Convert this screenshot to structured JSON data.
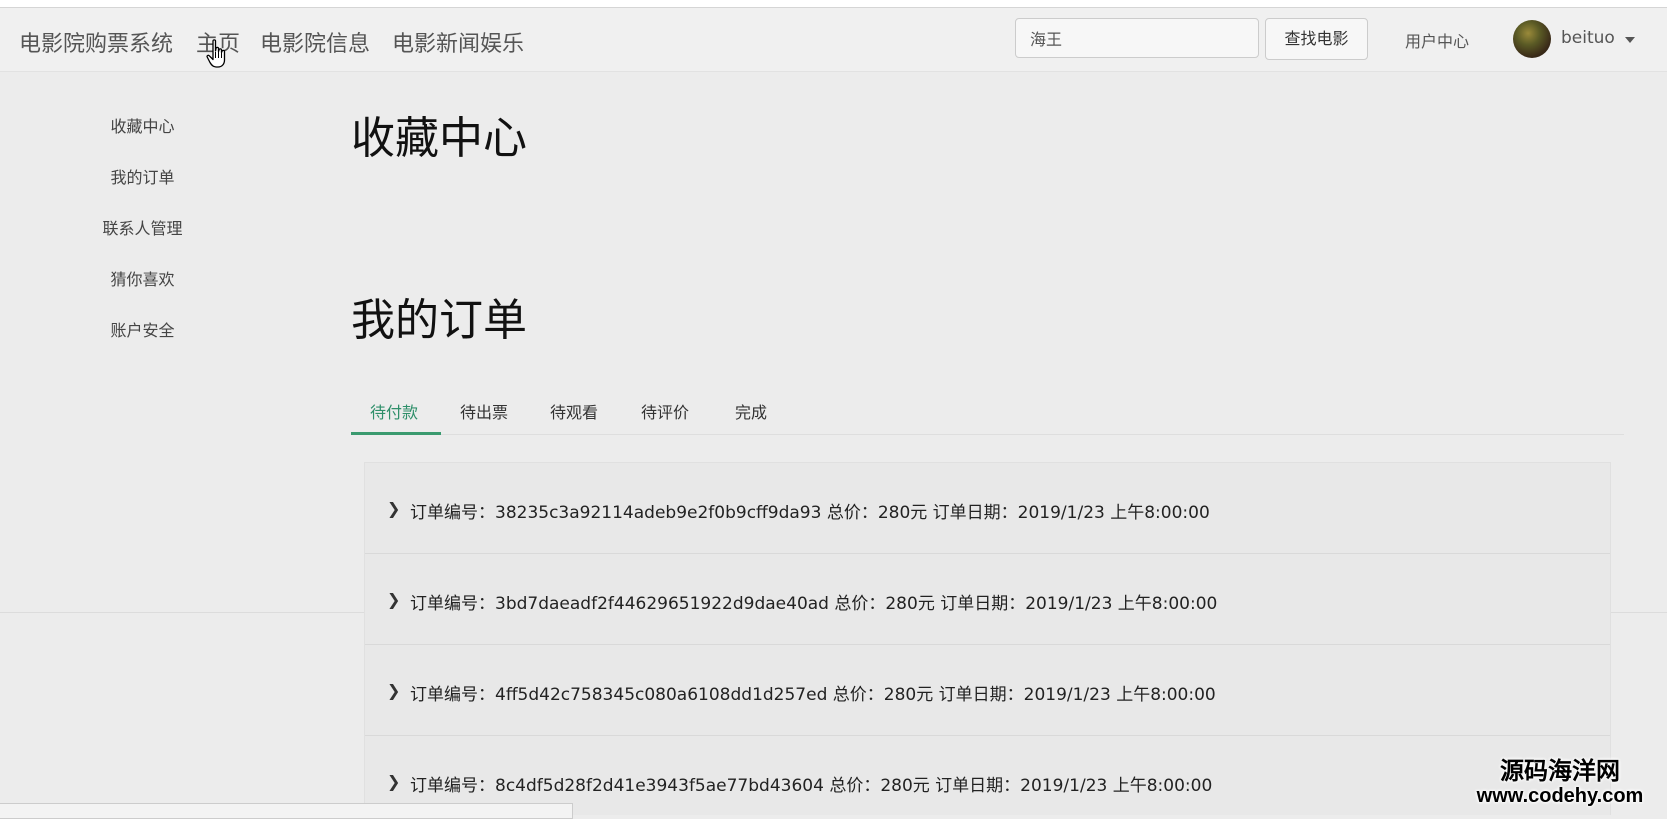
{
  "navbar": {
    "brand": "电影院购票系统",
    "links": [
      "主页",
      "电影院信息",
      "电影新闻娱乐"
    ],
    "search": {
      "value": "海王",
      "button_label": "查找电影"
    },
    "user_center": "用户中心",
    "username": "beituo"
  },
  "sidebar": {
    "items": [
      "收藏中心",
      "我的订单",
      "联系人管理",
      "猜你喜欢",
      "账户安全"
    ]
  },
  "main": {
    "favorites_title": "收藏中心",
    "orders_title": "我的订单",
    "tabs": [
      "待付款",
      "待出票",
      "待观看",
      "待评价",
      "完成"
    ],
    "active_tab": "待付款",
    "orders": [
      "订单编号：38235c3a92114adeb9e2f0b9cff9da93  总价：280元 订单日期：2019/1/23 上午8:00:00",
      "订单编号：3bd7daeadf2f44629651922d9dae40ad  总价：280元 订单日期：2019/1/23 上午8:00:00",
      "订单编号：4ff5d42c758345c080a6108dd1d257ed  总价：280元 订单日期：2019/1/23 上午8:00:00",
      "订单编号：8c4df5d28f2d41e3943f5ae77bd43604  总价：280元 订单日期：2019/1/23 上午8:00:00"
    ]
  },
  "watermark": {
    "line1": "源码海洋网",
    "line2": "www.codehy.com"
  },
  "colors": {
    "accent": "#3a9a6f",
    "background": "#ececec"
  }
}
